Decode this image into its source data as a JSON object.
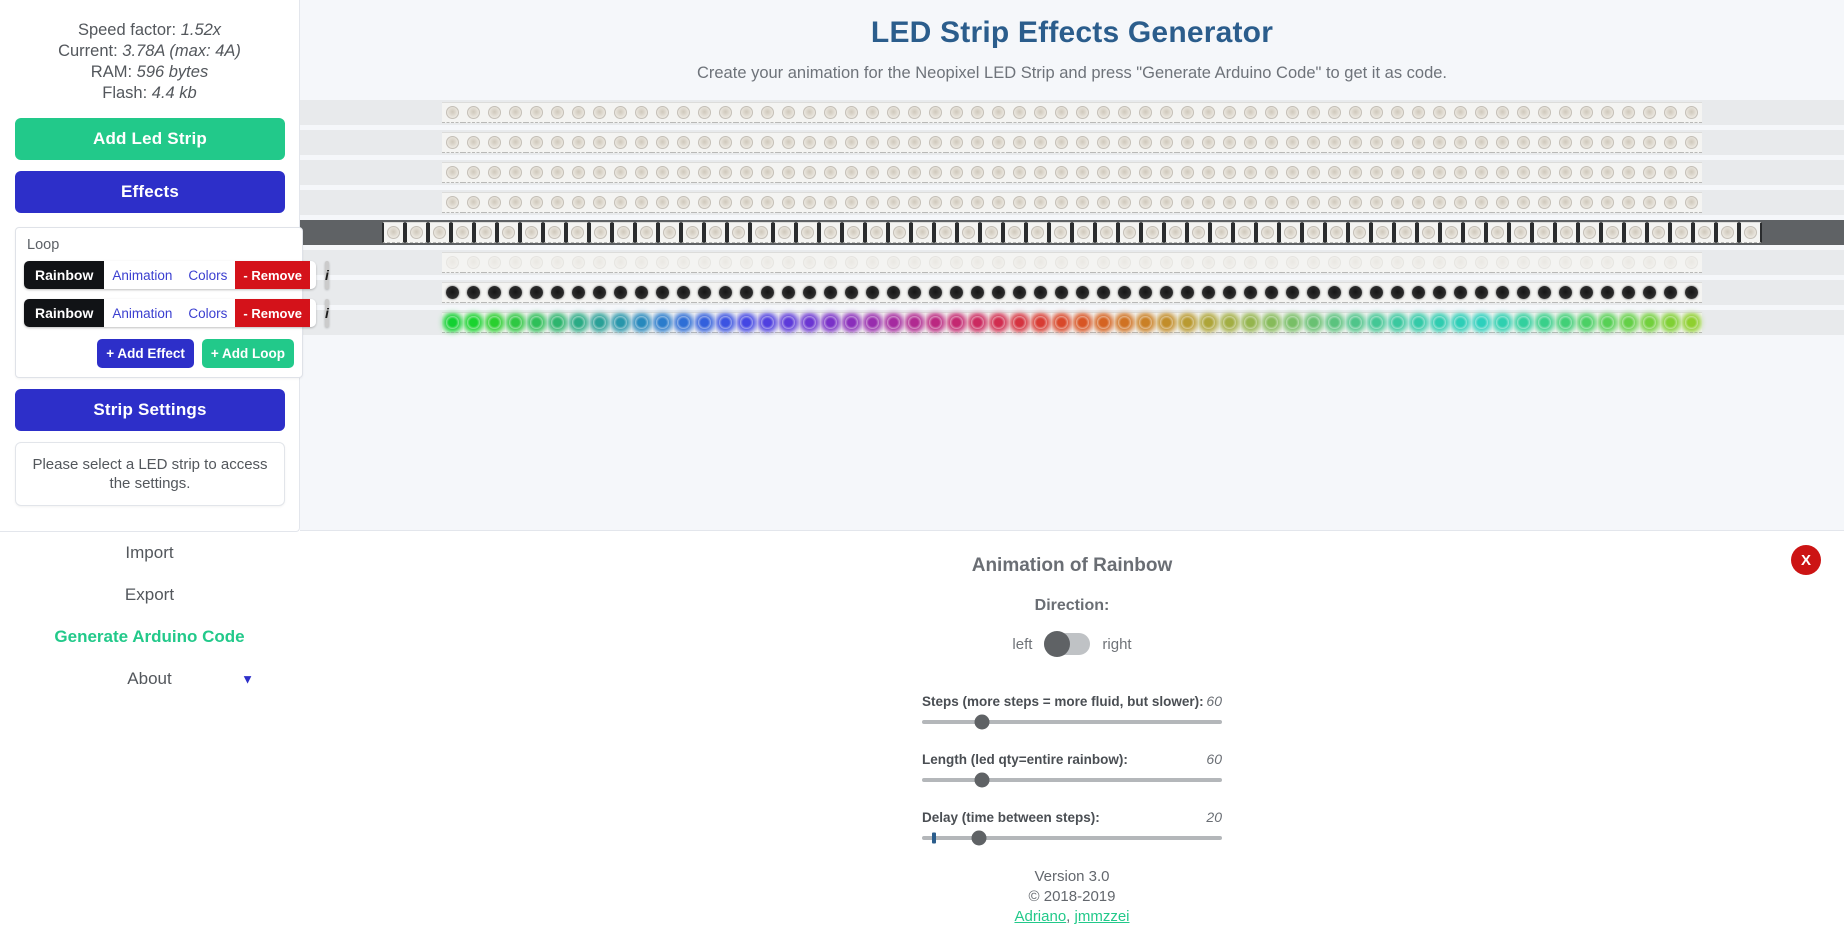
{
  "sidebar": {
    "stats": [
      {
        "label": "Speed factor:",
        "value": "1.52x"
      },
      {
        "label": "Current:",
        "value": "3.78A (max: 4A)"
      },
      {
        "label": "RAM:",
        "value": "596 bytes"
      },
      {
        "label": "Flash:",
        "value": "4.4 kb"
      }
    ],
    "add_strip_label": "Add Led Strip",
    "effects_label": "Effects",
    "effects_panel": {
      "loop_label": "Loop",
      "rows": [
        {
          "name": "Rainbow",
          "animation": "Animation",
          "colors": "Colors",
          "remove": "- Remove",
          "info": "i"
        },
        {
          "name": "Rainbow",
          "animation": "Animation",
          "colors": "Colors",
          "remove": "- Remove",
          "info": "i"
        }
      ],
      "add_effect_label": "+ Add Effect",
      "add_loop_label": "+ Add Loop"
    },
    "strip_settings_label": "Strip Settings",
    "strip_settings_note": "Please select a LED strip to access the settings.",
    "nav": [
      {
        "label": "Import",
        "accent": false
      },
      {
        "label": "Export",
        "accent": false
      },
      {
        "label": "Generate Arduino Code",
        "accent": true
      },
      {
        "label": "About",
        "accent": false,
        "caret": "▼"
      }
    ]
  },
  "header": {
    "title": "LED Strip Effects Generator",
    "subtitle": "Create your animation for the Neopixel LED Strip and press \"Generate Arduino Code\" to get it as code."
  },
  "strips": {
    "count": 8,
    "leds_per_strip": 60,
    "rows": [
      {
        "index": 0,
        "state": "chip",
        "selected": false
      },
      {
        "index": 1,
        "state": "chip",
        "selected": false
      },
      {
        "index": 2,
        "state": "chip",
        "selected": false
      },
      {
        "index": 3,
        "state": "chip",
        "selected": false
      },
      {
        "index": 4,
        "state": "chip",
        "selected": true
      },
      {
        "index": 5,
        "state": "faint",
        "selected": false
      },
      {
        "index": 6,
        "state": "off",
        "selected": false
      },
      {
        "index": 7,
        "state": "rainbow",
        "selected": false
      }
    ],
    "rainbow_colors": [
      "#12d132",
      "#19d42f",
      "#2ad02f",
      "#2fc843",
      "#2fbf59",
      "#2eb56e",
      "#2bab85",
      "#2aa097",
      "#2896ab",
      "#2789bd",
      "#2a7ccc",
      "#2e6ed6",
      "#3360dd",
      "#3b53e2",
      "#4447e4",
      "#5040e0",
      "#5d3ada",
      "#6b35d2",
      "#7a31c8",
      "#8a2ebb",
      "#982cae",
      "#a52aa0",
      "#b12991",
      "#bb2881",
      "#c42871",
      "#cb2a60",
      "#d12d50",
      "#d53340",
      "#d83c33",
      "#d9482a",
      "#d85524",
      "#d56321",
      "#d07222",
      "#ca8025",
      "#c28d2a",
      "#b99a31",
      "#aea539",
      "#a2ae43",
      "#94b54e",
      "#86bb5a",
      "#78bf66",
      "#69c172",
      "#5bc37e",
      "#4fc58a",
      "#44c795",
      "#3bc89f",
      "#34caa8",
      "#2fccb0",
      "#2dceb7",
      "#2dd0bd",
      "#2fd0b0",
      "#33d09e",
      "#39d08a",
      "#41d077",
      "#4bd065",
      "#57d055",
      "#64d047",
      "#72d03c",
      "#80d034",
      "#8fd02e"
    ]
  },
  "animation_panel": {
    "title": "Animation of Rainbow",
    "direction_label": "Direction:",
    "direction_left": "left",
    "direction_right": "right",
    "direction_value": "left",
    "close_label": "X",
    "sliders": [
      {
        "label": "Steps (more steps = more fluid, but slower):",
        "value": "60",
        "percent": 20,
        "tick": null
      },
      {
        "label": "Length (led qty=entire rainbow):",
        "value": "60",
        "percent": 20,
        "tick": null
      },
      {
        "label": "Delay (time between steps):",
        "value": "20",
        "percent": 19,
        "tick": 4
      }
    ],
    "footer": {
      "version": "Version 3.0",
      "copyright": "© 2018-2019",
      "author_1": "Adriano",
      "separator": ", ",
      "author_2": "jmmzzei"
    }
  }
}
